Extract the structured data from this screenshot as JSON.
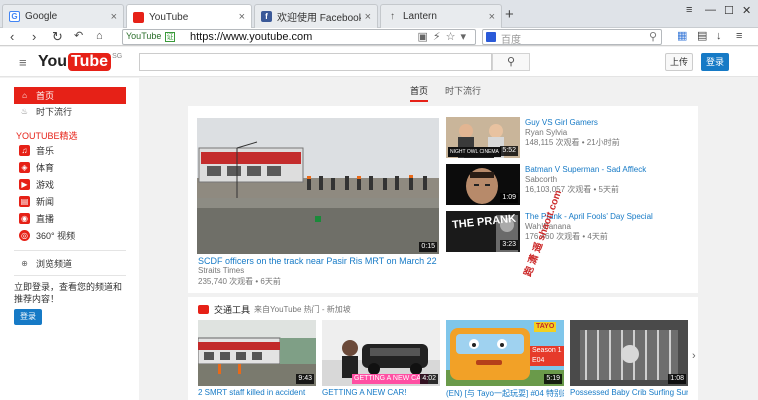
{
  "browser": {
    "tabs": [
      {
        "label": "Google",
        "color": "#4285f4"
      },
      {
        "label": "YouTube",
        "color": "#e62117"
      },
      {
        "label": "欢迎使用 Facebook - 登录",
        "color": "#3b5998"
      },
      {
        "label": "Lantern",
        "color": "#ffffff"
      }
    ],
    "site_label": "YouTube",
    "ssl_label": "证",
    "url": "https://www.youtube.com",
    "search_placeholder": "百度"
  },
  "masthead": {
    "logo_you": "You",
    "logo_tube": "Tube",
    "logo_region": "SG",
    "upload_label": "上传",
    "signin_label": "登录"
  },
  "sidebar": {
    "items": [
      {
        "label": "首页",
        "icon": "home-icon"
      },
      {
        "label": "时下流行",
        "icon": "flame-icon"
      }
    ],
    "section_title": "YOUTUBE精选",
    "channels": [
      {
        "label": "音乐",
        "icon": "music-icon"
      },
      {
        "label": "体育",
        "icon": "sports-icon"
      },
      {
        "label": "游戏",
        "icon": "gaming-icon"
      },
      {
        "label": "新闻",
        "icon": "news-icon"
      },
      {
        "label": "直播",
        "icon": "live-icon"
      },
      {
        "label": "360° 视频",
        "icon": "360-icon"
      }
    ],
    "browse_label": "浏览频道",
    "note": "立即登录，查看您的频道和推荐内容！",
    "login_label": "登录"
  },
  "feed_tabs": [
    "首页",
    "时下流行"
  ],
  "featured": {
    "title": "SCDF officers on the track near Pasir Ris MRT on March 22",
    "channel": "Straits Times",
    "meta": "235,740 次观看 • 6天前",
    "duration": "0:15"
  },
  "side_videos": [
    {
      "title": "Guy VS Girl Gamers",
      "channel": "Ryan Sylvia",
      "meta": "148,115 次观看 • 21小时前",
      "duration": "5:52",
      "overlay": "NIGHT OWL CINEMA"
    },
    {
      "title": "Batman V Superman - Sad Affleck",
      "channel": "Sabcorth",
      "meta": "16,103,057 次观看 • 5天前",
      "duration": "1:09",
      "overlay": ""
    },
    {
      "title": "The Prank - April Fools' Day Special",
      "channel": "Wah!Banana",
      "meta": "176,460 次观看 • 4天前",
      "duration": "3:23",
      "overlay": "THE PRANK"
    }
  ],
  "section": {
    "title": "交通工具",
    "subtitle": "来自YouTube 热门 - 新加坡",
    "videos": [
      {
        "title": "2 SMRT staff killed in accident",
        "duration": "9:43"
      },
      {
        "title": "GETTING A NEW CAR!",
        "duration": "4:02",
        "overlay": "GETTING A NEW CAR"
      },
      {
        "title": "(EN) [与 Tayo一起玩耍] #04 特别的一天",
        "duration": "5:19",
        "overlay": "Season 1 E04",
        "badge": "TAYO"
      },
      {
        "title": "Possessed Baby Crib Surfing Surv",
        "duration": "1:08"
      }
    ]
  },
  "watermark": "跑 潇 遥 shaoit.com"
}
